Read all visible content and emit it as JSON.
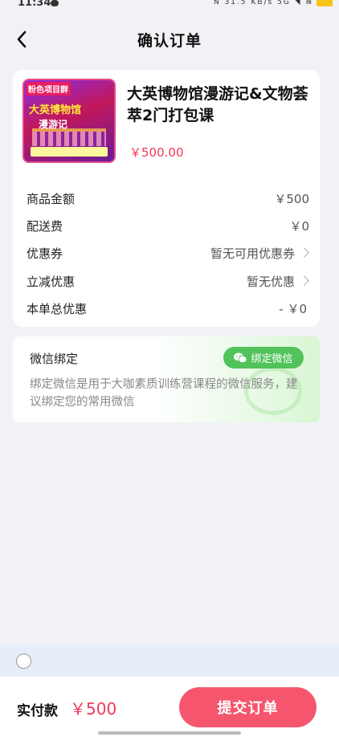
{
  "status_bar": {
    "time": "11:34",
    "icons": "N 31.5 KB/s 5G ◥ ⋒"
  },
  "nav": {
    "title": "确认订单",
    "back_icon": "chevron-left-icon"
  },
  "product": {
    "image_tag": "粉色项目群",
    "image_title": "大英博物馆",
    "image_sub": "漫游记",
    "title": "大英博物馆漫游记&文物荟萃2门打包课",
    "price": "￥500.00"
  },
  "fees": [
    {
      "label": "商品金额",
      "value": "￥500"
    },
    {
      "label": "配送费",
      "value": "￥0"
    },
    {
      "label": "优惠券",
      "value": "暂无可用优惠券"
    },
    {
      "label": "立减优惠",
      "value": "暂无优惠"
    },
    {
      "label": "本单总优惠",
      "value": "- ￥0"
    }
  ],
  "wechat": {
    "title": "微信绑定",
    "button_label": "绑定微信",
    "description": "绑定微信是用于大咖素质训练营课程的微信服务，建议绑定您的常用微信"
  },
  "footer": {
    "pay_label": "实付款",
    "pay_amount": "￥500",
    "submit_label": "提交订单"
  },
  "colors": {
    "accent": "#f0365a",
    "submit": "#f5566e",
    "wechat_green": "#52c35a",
    "background": "#f2f2f6"
  }
}
